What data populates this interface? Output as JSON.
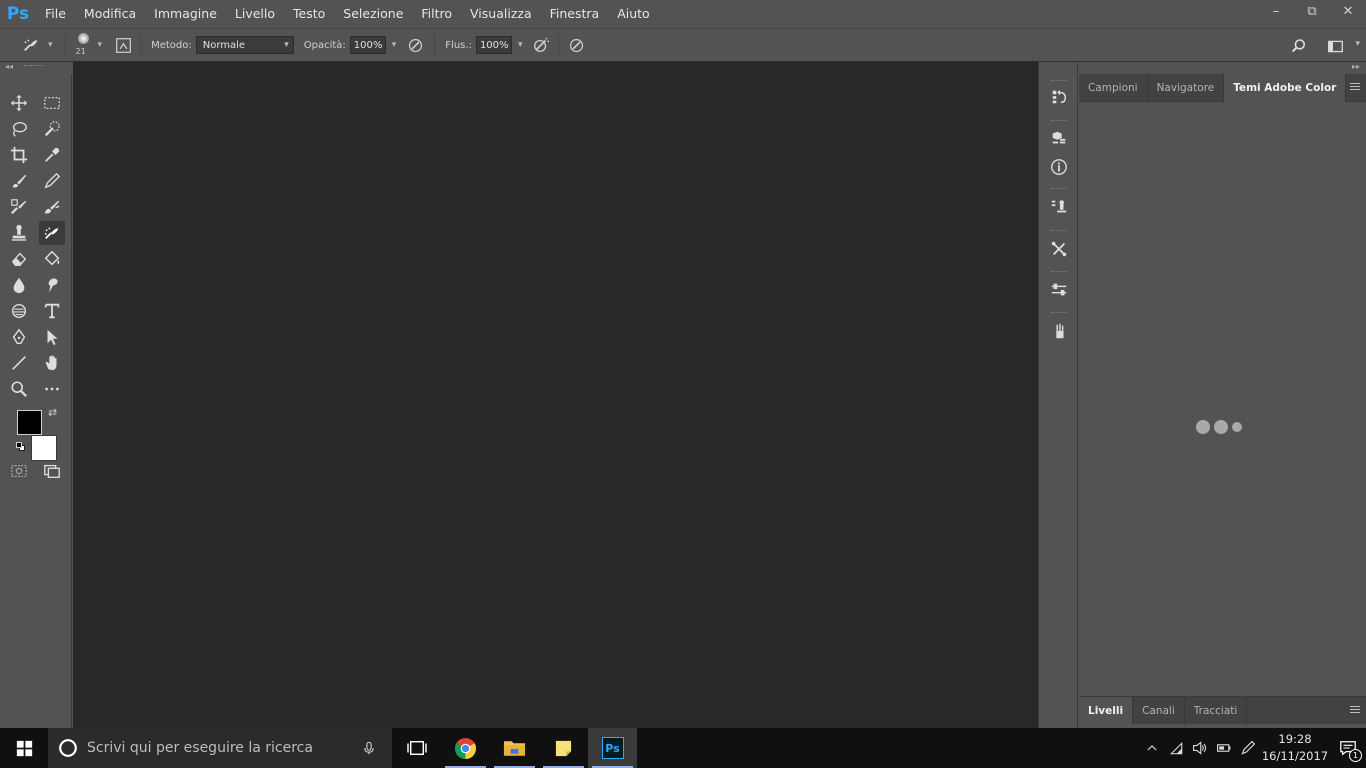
{
  "app": {
    "logo": "Ps"
  },
  "menu": [
    "File",
    "Modifica",
    "Immagine",
    "Livello",
    "Testo",
    "Selezione",
    "Filtro",
    "Visualizza",
    "Finestra",
    "Aiuto"
  ],
  "window_controls": {
    "minimize": "–",
    "restore": "⧉",
    "close": "✕"
  },
  "options": {
    "brush_size": "21",
    "mode_label": "Metodo:",
    "mode_value": "Normale",
    "opacity_label": "Opacità:",
    "opacity_value": "100%",
    "flow_label": "Flus.:",
    "flow_value": "100%"
  },
  "right_panel": {
    "tabs": [
      "Campioni",
      "Navigatore",
      "Temi Adobe Color"
    ],
    "active_tab": "Temi Adobe Color",
    "bottom_tabs": [
      "Livelli",
      "Canali",
      "Tracciati"
    ],
    "active_bottom_tab": "Livelli"
  },
  "taskbar": {
    "search_placeholder": "Scrivi qui per eseguire la ricerca",
    "time": "19:28",
    "date": "16/11/2017",
    "notification_count": "1"
  },
  "colors": {
    "accent": "#31a8ff",
    "ui_bg": "#535353",
    "canvas_bg": "#282828",
    "foreground_swatch": "#000000",
    "background_swatch": "#ffffff"
  }
}
